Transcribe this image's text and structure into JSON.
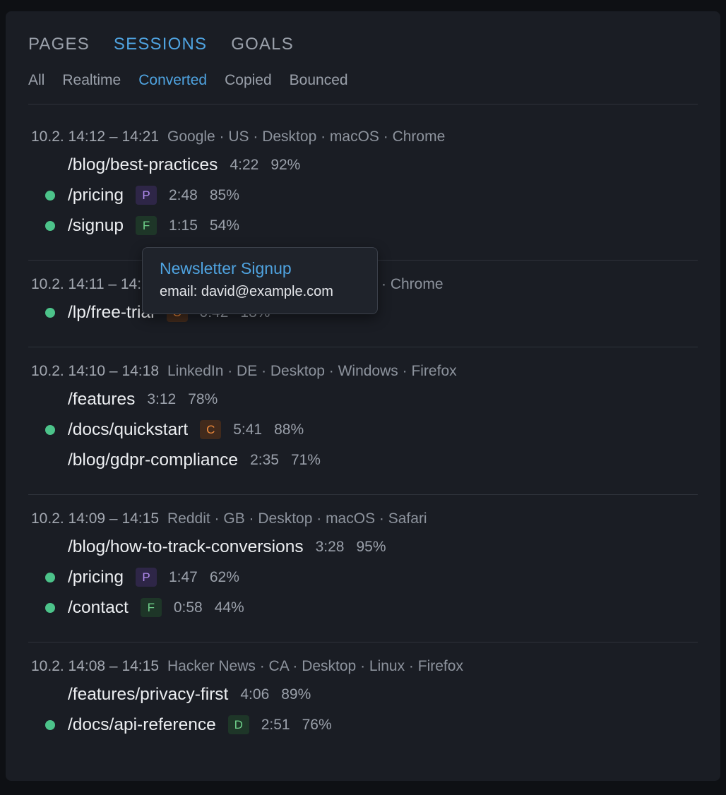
{
  "tabs": [
    {
      "label": "PAGES"
    },
    {
      "label": "SESSIONS"
    },
    {
      "label": "GOALS"
    }
  ],
  "filters": [
    {
      "label": "All"
    },
    {
      "label": "Realtime"
    },
    {
      "label": "Converted"
    },
    {
      "label": "Copied"
    },
    {
      "label": "Bounced"
    }
  ],
  "sessions": [
    {
      "time": "10.2. 14:12 – 14:21",
      "info": "Google · US · Desktop · macOS · Chrome",
      "rows": [
        {
          "path": "/blog/best-practices",
          "duration": "4:22",
          "percent": "92%"
        },
        {
          "path": "/pricing",
          "badge": "P",
          "duration": "2:48",
          "percent": "85%"
        },
        {
          "path": "/signup",
          "badge": "F",
          "duration": "1:15",
          "percent": "54%"
        }
      ]
    },
    {
      "time": "10.2. 14:11 – 14:",
      "info": "· Chrome",
      "rows": [
        {
          "path": "/lp/free-trial",
          "badge": "C",
          "duration": "0:42",
          "percent": "18%"
        }
      ]
    },
    {
      "time": "10.2. 14:10 – 14:18",
      "info": "LinkedIn · DE · Desktop · Windows · Firefox",
      "rows": [
        {
          "path": "/features",
          "duration": "3:12",
          "percent": "78%"
        },
        {
          "path": "/docs/quickstart",
          "badge": "C",
          "duration": "5:41",
          "percent": "88%"
        },
        {
          "path": "/blog/gdpr-compliance",
          "duration": "2:35",
          "percent": "71%"
        }
      ]
    },
    {
      "time": "10.2. 14:09 – 14:15",
      "info": "Reddit · GB · Desktop · macOS · Safari",
      "rows": [
        {
          "path": "/blog/how-to-track-conversions",
          "duration": "3:28",
          "percent": "95%"
        },
        {
          "path": "/pricing",
          "badge": "P",
          "duration": "1:47",
          "percent": "62%"
        },
        {
          "path": "/contact",
          "badge": "F",
          "duration": "0:58",
          "percent": "44%"
        }
      ]
    },
    {
      "time": "10.2. 14:08 – 14:15",
      "info": "Hacker News · CA · Desktop · Linux · Firefox",
      "rows": [
        {
          "path": "/features/privacy-first",
          "duration": "4:06",
          "percent": "89%"
        },
        {
          "path": "/docs/api-reference",
          "badge": "D",
          "duration": "2:51",
          "percent": "76%"
        }
      ]
    }
  ],
  "tooltip": {
    "title": "Newsletter Signup",
    "detail": "email: david@example.com"
  }
}
